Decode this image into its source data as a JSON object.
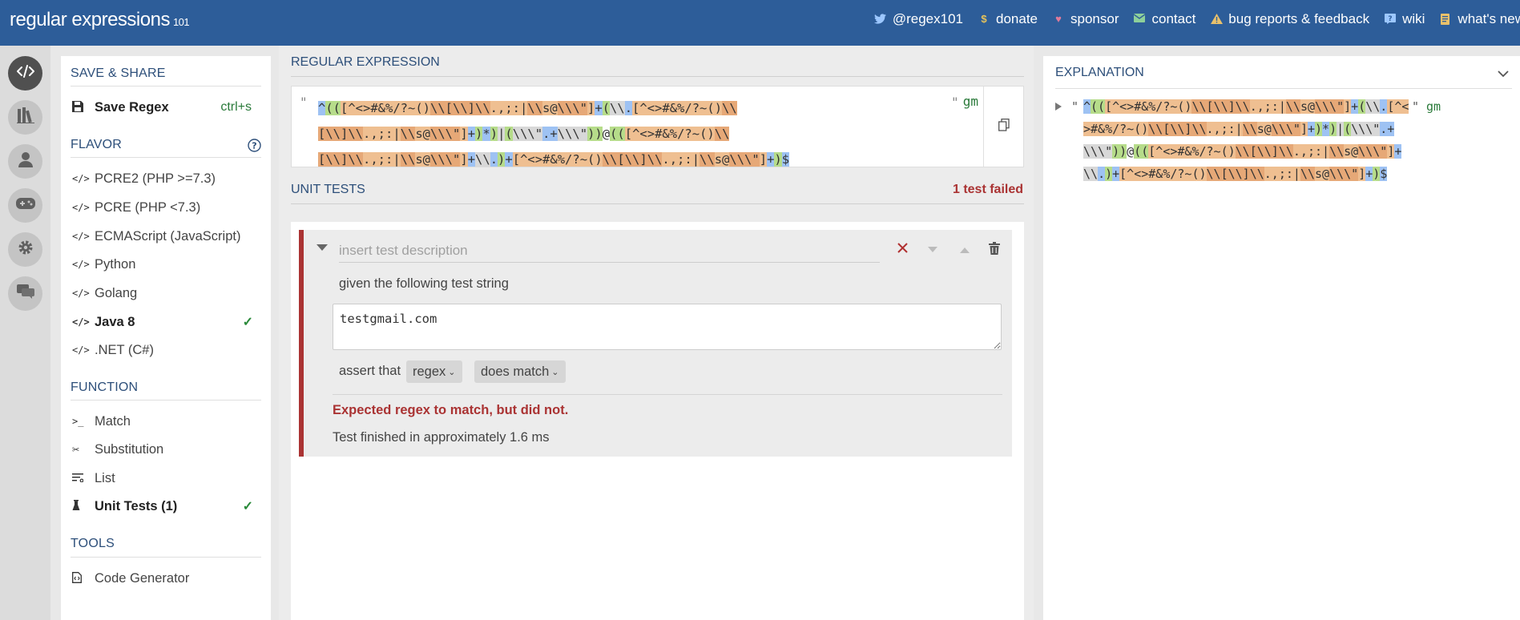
{
  "app": {
    "logo_main": "regular expressions",
    "logo_version": "101"
  },
  "topnav": [
    {
      "label": "@regex101",
      "icon": "twitter-icon"
    },
    {
      "label": "donate",
      "icon": "dollar-icon"
    },
    {
      "label": "sponsor",
      "icon": "heart-icon"
    },
    {
      "label": "contact",
      "icon": "mail-icon"
    },
    {
      "label": "bug reports & feedback",
      "icon": "warning-icon"
    },
    {
      "label": "wiki",
      "icon": "help-icon"
    },
    {
      "label": "what's new",
      "icon": "document-icon"
    }
  ],
  "rail": [
    "code-icon",
    "library-icon",
    "user-icon",
    "gamepad-icon",
    "settings-icon",
    "chat-icon"
  ],
  "sidebar": {
    "save_share_title": "SAVE & SHARE",
    "save_regex_label": "Save Regex",
    "save_shortcut": "ctrl+s",
    "flavor_title": "FLAVOR",
    "flavors": [
      {
        "label": "PCRE2 (PHP >=7.3)",
        "selected": false
      },
      {
        "label": "PCRE (PHP <7.3)",
        "selected": false
      },
      {
        "label": "ECMAScript (JavaScript)",
        "selected": false
      },
      {
        "label": "Python",
        "selected": false
      },
      {
        "label": "Golang",
        "selected": false
      },
      {
        "label": "Java 8",
        "selected": true
      },
      {
        "label": ".NET (C#)",
        "selected": false
      }
    ],
    "function_title": "FUNCTION",
    "functions": [
      {
        "label": "Match",
        "icon": "terminal-icon",
        "selected": false
      },
      {
        "label": "Substitution",
        "icon": "scissors-icon",
        "selected": false
      },
      {
        "label": "List",
        "icon": "list-icon",
        "selected": false
      },
      {
        "label": "Unit Tests (1)",
        "icon": "flask-icon",
        "selected": true
      }
    ],
    "tools_title": "TOOLS",
    "code_generator_label": "Code Generator"
  },
  "main": {
    "regex_title": "REGULAR EXPRESSION",
    "regex_open_quote": "\"",
    "regex_close_quote": "\"",
    "regex_flags": "gm",
    "regex_lines": [
      "^(([^<>#&%/?~()\\\\[\\\\]\\\\.,;:|\\\\s@\\\\\"]+(\\\\.[^<>#&%/?~()\\\\",
      "[\\\\]\\\\.,;:|\\\\s@\\\\\"]+)*)|(\\\\\".+\\\\\"))@(([^<>#&%/?~()\\\\",
      "[\\\\]\\\\.,;:|\\\\s@\\\\\"]+\\\\.)+[^<>#&%/?~()\\\\[\\\\]\\\\.,;:|\\\\s@\\\\\"]+)$"
    ],
    "unit_tests_title": "UNIT TESTS",
    "failed_text": "1 test failed",
    "test": {
      "description_placeholder": "insert test description",
      "given_label": "given the following test string",
      "test_string": "testgmail.com",
      "assert_label": "assert that",
      "assert_subject": "regex",
      "assert_condition": "does match",
      "error_text": "Expected regex to match, but did not.",
      "time_text": "Test finished in approximately 1.6 ms"
    }
  },
  "explanation": {
    "title": "EXPLANATION",
    "open_quote": "\"",
    "close_quote": "\"",
    "flags": "gm",
    "lines": [
      "^(([^<>#&%/?~()\\\\[\\\\]\\\\.,;:|\\\\s@\\\\\"]+(\\\\.[^<",
      ">#&%/?~()\\\\[\\\\]\\\\.,;:|\\\\s@\\\\\"]+)*)|(\\\\\".+",
      "\\\\\"))@(([^<>#&%/?~()\\\\[\\\\]\\\\.,;:|\\\\s@\\\\\"]+",
      "\\\\.)+[^<>#&%/?~()\\\\[\\\\]\\\\.,;:|\\\\s@\\\\\"]+)$"
    ]
  },
  "colors": {
    "topbar": "#2d5d99",
    "fail_red": "#aa3333",
    "check_green": "#2a8a3a",
    "hl_blue": "#9ec2f3",
    "hl_green": "#b6dc8a",
    "hl_orange": "#efbf91"
  }
}
